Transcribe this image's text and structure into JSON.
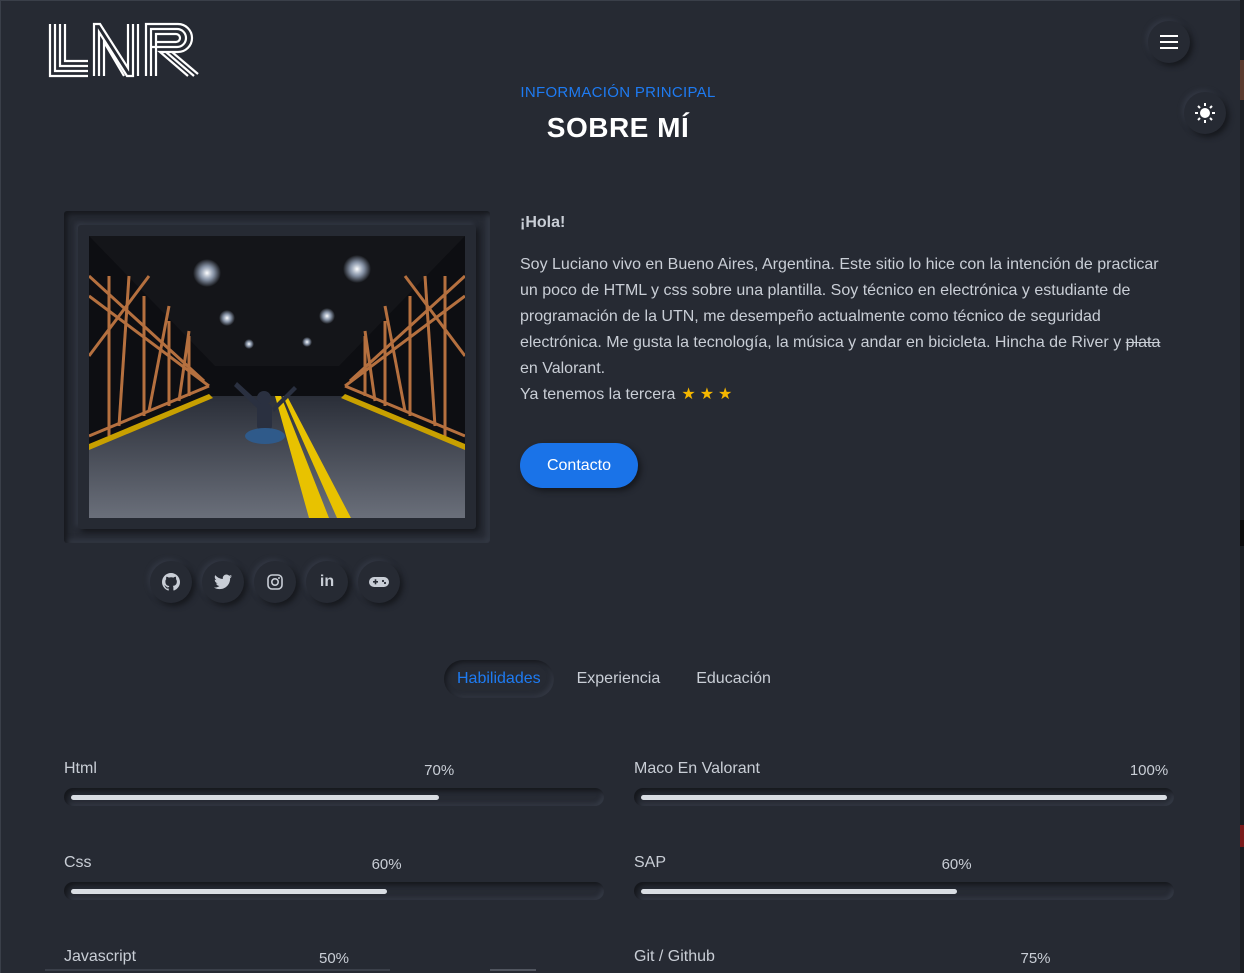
{
  "header": {
    "logo_text": "LNR",
    "menu_icon": "hamburger-icon",
    "theme_icon": "sun-icon"
  },
  "section": {
    "eyebrow": "INFORMACIÓN PRINCIPAL",
    "title": "SOBRE MÍ"
  },
  "about": {
    "greeting": "¡Hola!",
    "bio_main": "Soy Luciano vivo en Bueno Aires, Argentina. Este sitio lo hice con la intención de practicar un poco de HTML y css sobre una plantilla. Soy técnico en electrónica y estudiante de programación de la UTN, me desempeño actualmente como técnico de seguridad electrónica. Me gusta la tecnología, la música y andar en bicicleta. Hincha de River y",
    "bio_strike": "plata",
    "bio_end": "en Valorant.",
    "bio_line2": "Ya tenemos la tercera",
    "stars": "★★★",
    "contact_label": "Contacto"
  },
  "socials": [
    {
      "name": "github-icon",
      "glyph": "⊙"
    },
    {
      "name": "twitter-icon",
      "glyph": "🐦"
    },
    {
      "name": "instagram-icon",
      "glyph": "◎"
    },
    {
      "name": "linkedin-icon",
      "glyph": "in"
    },
    {
      "name": "gamepad-icon",
      "glyph": "🎮"
    }
  ],
  "tabs": [
    {
      "label": "Habilidades",
      "active": true
    },
    {
      "label": "Experiencia",
      "active": false
    },
    {
      "label": "Educación",
      "active": false
    }
  ],
  "skills": [
    {
      "name": "Html",
      "percent_label": "70%",
      "value": 70
    },
    {
      "name": "Maco En Valorant",
      "percent_label": "100%",
      "value": 100
    },
    {
      "name": "Css",
      "percent_label": "60%",
      "value": 60
    },
    {
      "name": "SAP",
      "percent_label": "60%",
      "value": 60
    },
    {
      "name": "Javascript",
      "percent_label": "50%",
      "value": 50
    },
    {
      "name": "Git / Github",
      "percent_label": "75%",
      "value": 75
    }
  ],
  "colors": {
    "background": "#262a33",
    "accent": "#1a73e8",
    "star": "#f5b700"
  }
}
